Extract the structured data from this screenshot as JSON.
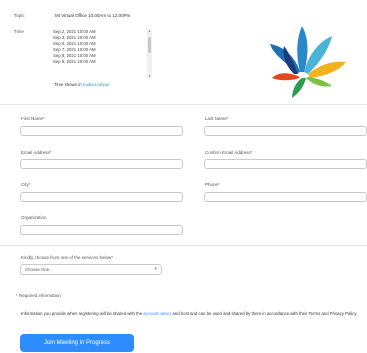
{
  "meeting": {
    "topic_label": "Topic",
    "topic_value": "MI Virtual Office 10.00Am to 12.00Pm",
    "time_label": "Time",
    "times": [
      "Sep 2, 2021 10:00 AM",
      "Sep 3, 2021 10:00 AM",
      "Sep 6, 2021 10:00 AM",
      "Sep 7, 2021 10:00 AM",
      "Sep 8, 2021 10:00 AM",
      "Sep 9, 2021 10:00 AM"
    ],
    "time_shown_prefix": "Time shown in",
    "time_zone_link": "Kuala Lumpur"
  },
  "form": {
    "first_name_label": "First Name",
    "last_name_label": "Last Name",
    "email_label": "Email Address",
    "confirm_email_label": "Confirm Email Address",
    "city_label": "City",
    "phone_label": "Phone",
    "organization_label": "Organization",
    "services_label": "Kindly choose from one of the services below",
    "services_selected": "Choose One...",
    "required_note": "Required information",
    "required_star": "*"
  },
  "disclaimer": {
    "text_before": "Information you provide when registering will be shared with the",
    "account_owner_link": "account owner",
    "text_after": "and host and can be used and shared by them in accordance with their Terms and Privacy Policy."
  },
  "submit_label": "Join Meeting in Progress",
  "colors": {
    "accent": "#2d8cff",
    "required": "#e02828"
  }
}
